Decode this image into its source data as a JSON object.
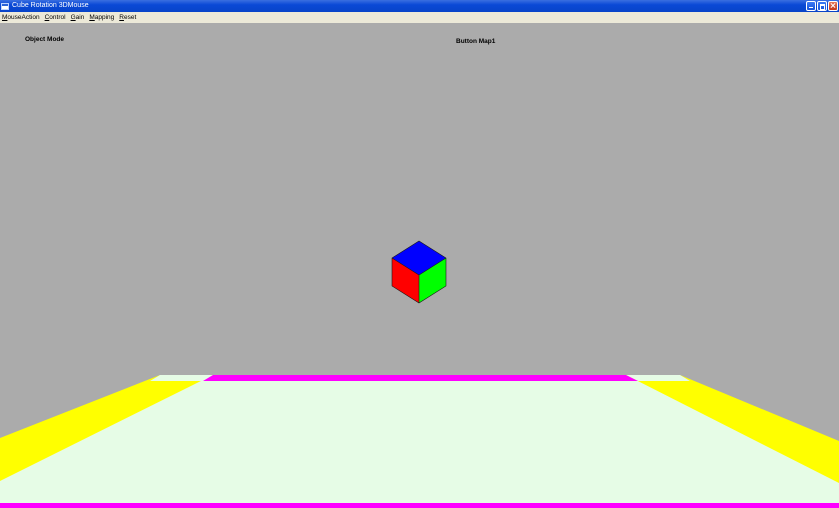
{
  "window": {
    "title": "Cube Rotation 3DMouse"
  },
  "menu": {
    "items": [
      {
        "first": "M",
        "rest": "ouseAction"
      },
      {
        "first": "C",
        "rest": "ontrol"
      },
      {
        "first": "G",
        "rest": "ain"
      },
      {
        "first": "M",
        "rest": "apping"
      },
      {
        "first": "R",
        "rest": "eset"
      }
    ]
  },
  "overlay": {
    "mode_label": "Object Mode",
    "map_label": "Button Map1"
  },
  "colors": {
    "background": "#ababab",
    "floor": "#e6fce6",
    "floor_side": "#ffff00",
    "floor_edge": "#ff00ff",
    "cube_top": "#0000ff",
    "cube_left": "#ff0000",
    "cube_right": "#00ff00"
  }
}
